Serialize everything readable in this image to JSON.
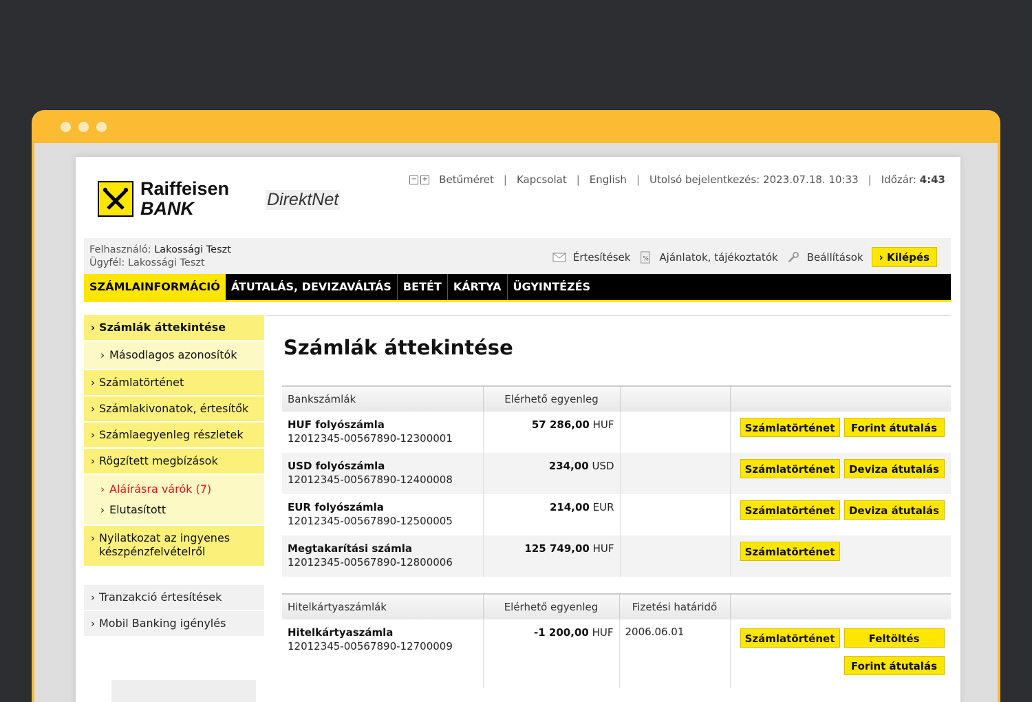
{
  "header": {
    "bank_name_line1": "Raiffeisen",
    "bank_name_line2": "BANK",
    "product": "DirektNet",
    "font_size_link": "Betűméret",
    "contact_link": "Kapcsolat",
    "language_link": "English",
    "last_login": "Utolsó bejelentkezés: 2023.07.18. 10:33",
    "timer_label": "Időzár:",
    "timer_value": "4:43"
  },
  "user": {
    "user_label": "Felhasználó:",
    "user_name": "Lakossági Teszt",
    "client_label": "Ügyfél:",
    "client_name": "Lakossági Teszt"
  },
  "actions": {
    "notifications": "Értesítések",
    "offers": "Ajánlatok, tájékoztatók",
    "settings": "Beállítások",
    "logout": "Kilépés"
  },
  "nav": [
    "SZÁMLAINFORMÁCIÓ",
    "ÁTUTALÁS, DEVIZAVÁLTÁS",
    "BETÉT",
    "KÁRTYA",
    "ÜGYINTÉZÉS"
  ],
  "sidebar": {
    "overview": "Számlák áttekintése",
    "secondary_ids": "Másodlagos azonosítók",
    "history": "Számlatörténet",
    "statements": "Számlakivonatok, értesítők",
    "balance_details": "Számlaegyenleg részletek",
    "fixed_orders": "Rögzített megbízások",
    "awaiting_signature": "Aláírásra várók (7)",
    "rejected": "Elutasított",
    "free_cash_line1": "Nyilatkozat az ingyenes",
    "free_cash_line2": "készpénzfelvételről",
    "transaction_notifications": "Tranzakció értesítések",
    "mobile_banking": "Mobil Banking igénylés"
  },
  "main": {
    "title": "Számlák áttekintése",
    "bank_table": {
      "col_accounts": "Bankszámlák",
      "col_balance": "Elérhető egyenleg",
      "rows": [
        {
          "name": "HUF folyószámla",
          "number": "12012345-00567890-12300001",
          "balance": "57 286,00",
          "currency": "HUF",
          "btn1": "Számlatörténet",
          "btn2": "Forint átutalás"
        },
        {
          "name": "USD folyószámla",
          "number": "12012345-00567890-12400008",
          "balance": "234,00",
          "currency": "USD",
          "btn1": "Számlatörténet",
          "btn2": "Deviza átutalás"
        },
        {
          "name": "EUR folyószámla",
          "number": "12012345-00567890-12500005",
          "balance": "214,00",
          "currency": "EUR",
          "btn1": "Számlatörténet",
          "btn2": "Deviza átutalás"
        },
        {
          "name": "Megtakarítási számla",
          "number": "12012345-00567890-12800006",
          "balance": "125 749,00",
          "currency": "HUF",
          "btn1": "Számlatörténet"
        }
      ]
    },
    "card_table": {
      "col_accounts": "Hitelkártyaszámlák",
      "col_balance": "Elérhető egyenleg",
      "col_due": "Fizetési határidő",
      "rows": [
        {
          "name": "Hitelkártyaszámla",
          "number": "12012345-00567890-12700009",
          "balance": "-1 200,00",
          "currency": "HUF",
          "due": "2006.06.01",
          "btn1": "Számlatörténet",
          "btn2": "Feltöltés",
          "btn3": "Forint átutalás"
        }
      ]
    }
  },
  "colors": {
    "brand_yellow": "#ffe600",
    "nav_black": "#000000",
    "alert_red": "#e2121b",
    "frame_orange": "#fbbb33"
  }
}
